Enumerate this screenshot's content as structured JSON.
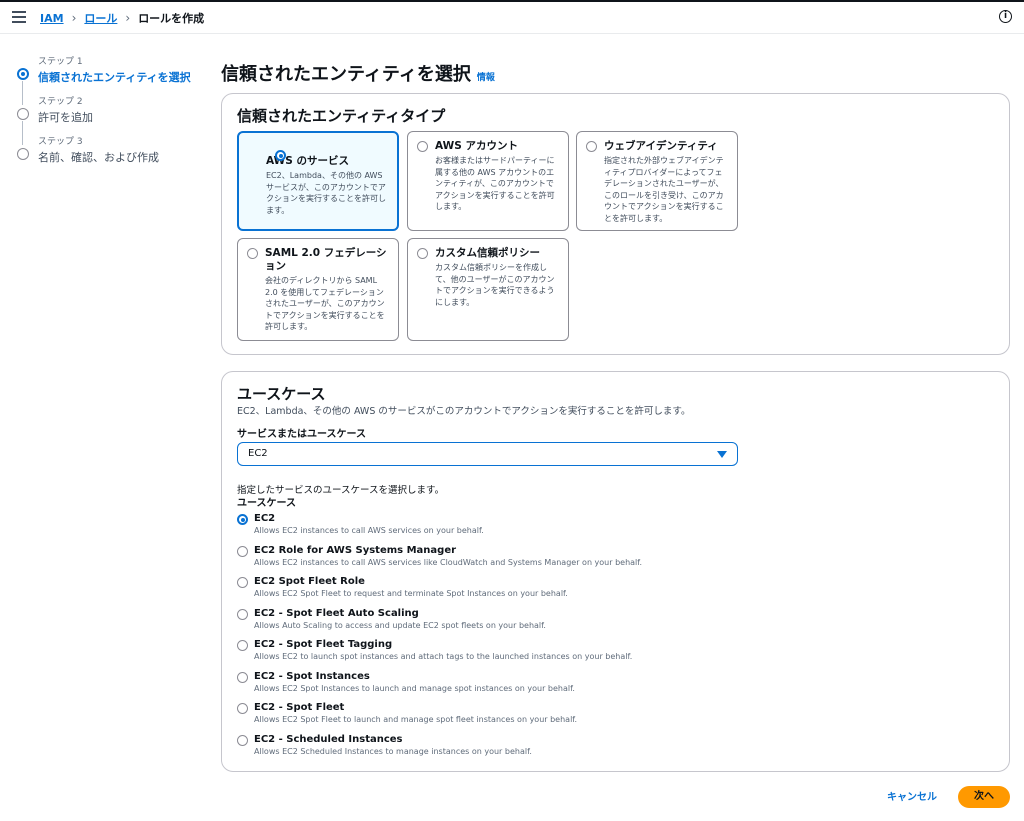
{
  "breadcrumb": {
    "iam": "IAM",
    "roles": "ロール",
    "current": "ロールを作成"
  },
  "steps": [
    {
      "small": "ステップ 1",
      "label": "信頼されたエンティティを選択",
      "active": true
    },
    {
      "small": "ステップ 2",
      "label": "許可を追加",
      "active": false
    },
    {
      "small": "ステップ 3",
      "label": "名前、確認、および作成",
      "active": false
    }
  ],
  "page": {
    "title": "信頼されたエンティティを選択",
    "info": "情報"
  },
  "entity_panel": {
    "title": "信頼されたエンティティタイプ",
    "tiles": [
      {
        "title": "AWS のサービス",
        "desc": "EC2、Lambda、その他の AWS サービスが、このアカウントでアクションを実行することを許可します。",
        "selected": true
      },
      {
        "title": "AWS アカウント",
        "desc": "お客様またはサードパーティーに属する他の AWS アカウントのエンティティが、このアカウントでアクションを実行することを許可します。",
        "selected": false
      },
      {
        "title": "ウェブアイデンティティ",
        "desc": "指定された外部ウェブアイデンティティプロバイダーによってフェデレーションされたユーザーが、このロールを引き受け、このアカウントでアクションを実行することを許可します。",
        "selected": false
      },
      {
        "title": "SAML 2.0 フェデレーション",
        "desc": "会社のディレクトリから SAML 2.0 を使用してフェデレーションされたユーザーが、このアカウントでアクションを実行することを許可します。",
        "selected": false
      },
      {
        "title": "カスタム信頼ポリシー",
        "desc": "カスタム信頼ポリシーを作成して、他のユーザーがこのアカウントでアクションを実行できるようにします。",
        "selected": false
      }
    ]
  },
  "usecase_panel": {
    "title": "ユースケース",
    "desc": "EC2、Lambda、その他の AWS のサービスがこのアカウントでアクションを実行することを許可します。",
    "field_label": "サービスまたはユースケース",
    "selected_value": "EC2",
    "choose_text": "指定したサービスのユースケースを選択します。",
    "list_header": "ユースケース",
    "items": [
      {
        "title": "EC2",
        "desc": "Allows EC2 instances to call AWS services on your behalf.",
        "checked": true
      },
      {
        "title": "EC2 Role for AWS Systems Manager",
        "desc": "Allows EC2 instances to call AWS services like CloudWatch and Systems Manager on your behalf.",
        "checked": false
      },
      {
        "title": "EC2 Spot Fleet Role",
        "desc": "Allows EC2 Spot Fleet to request and terminate Spot Instances on your behalf.",
        "checked": false
      },
      {
        "title": "EC2 - Spot Fleet Auto Scaling",
        "desc": "Allows Auto Scaling to access and update EC2 spot fleets on your behalf.",
        "checked": false
      },
      {
        "title": "EC2 - Spot Fleet Tagging",
        "desc": "Allows EC2 to launch spot instances and attach tags to the launched instances on your behalf.",
        "checked": false
      },
      {
        "title": "EC2 - Spot Instances",
        "desc": "Allows EC2 Spot Instances to launch and manage spot instances on your behalf.",
        "checked": false
      },
      {
        "title": "EC2 - Spot Fleet",
        "desc": "Allows EC2 Spot Fleet to launch and manage spot fleet instances on your behalf.",
        "checked": false
      },
      {
        "title": "EC2 - Scheduled Instances",
        "desc": "Allows EC2 Scheduled Instances to manage instances on your behalf.",
        "checked": false
      }
    ]
  },
  "footer": {
    "cancel": "キャンセル",
    "next": "次へ"
  }
}
